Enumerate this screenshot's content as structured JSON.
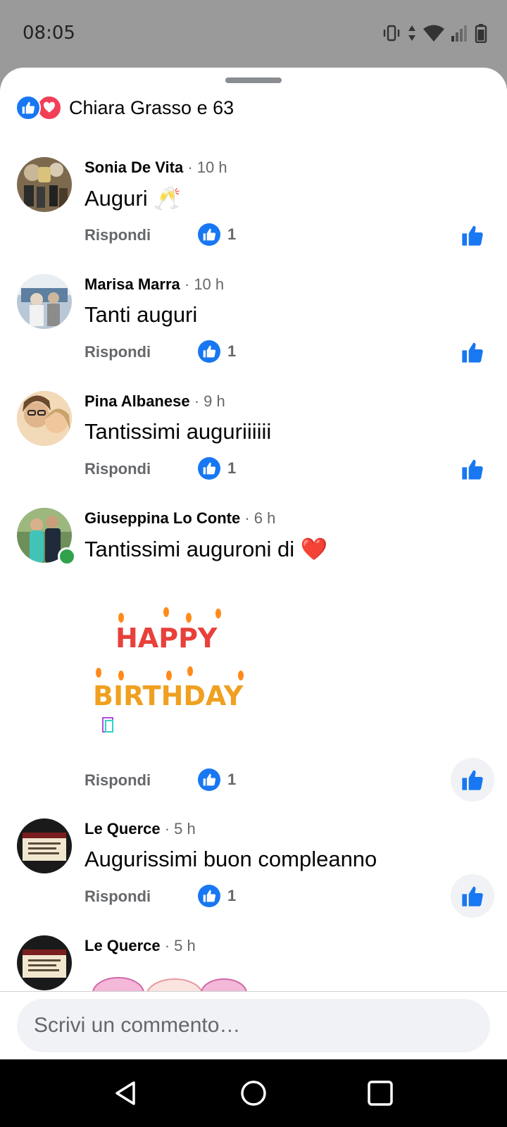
{
  "status_bar": {
    "time": "08:05",
    "icons": [
      "vibrate-icon",
      "data-arrows-icon",
      "wifi-icon",
      "signal-icon",
      "battery-icon"
    ]
  },
  "header": {
    "reaction_icons": [
      "like-icon",
      "love-icon"
    ],
    "summary": "Chiara Grasso e 63"
  },
  "comments": [
    {
      "author": "Sonia De Vita",
      "time": "· 10 h",
      "text": "Auguri 🥂",
      "reply": "Rispondi",
      "likes": "1",
      "liked": true
    },
    {
      "author": "Marisa Marra",
      "time": "· 10 h",
      "text": "Tanti auguri",
      "reply": "Rispondi",
      "likes": "1",
      "liked": true
    },
    {
      "author": "Pina Albanese",
      "time": "· 9 h",
      "text": "Tantissimi auguriiiiii",
      "reply": "Rispondi",
      "likes": "1",
      "liked": true
    },
    {
      "author": "Giuseppina Lo Conte",
      "time": "· 6 h",
      "text": "Tantissimi auguroni di ❤️",
      "reply": "Rispondi",
      "likes": "1",
      "liked": true,
      "online": true,
      "sticker_line1": "HAPPY",
      "sticker_line2": "BIRTHDAY"
    },
    {
      "author": "Le Querce",
      "time": "· 5 h",
      "text": "Augurissimi buon compleanno",
      "reply": "Rispondi",
      "likes": "1",
      "liked": true
    },
    {
      "author": "Le Querce",
      "time": "· 5 h"
    }
  ],
  "composer": {
    "placeholder": "Scrivi un commento…"
  },
  "navigation": {
    "buttons": [
      "back-icon",
      "home-icon",
      "recents-icon"
    ]
  },
  "colors": {
    "accent": "#1877f2",
    "love": "#f33e58",
    "online": "#31a24c",
    "secondary_text": "#65676b"
  }
}
